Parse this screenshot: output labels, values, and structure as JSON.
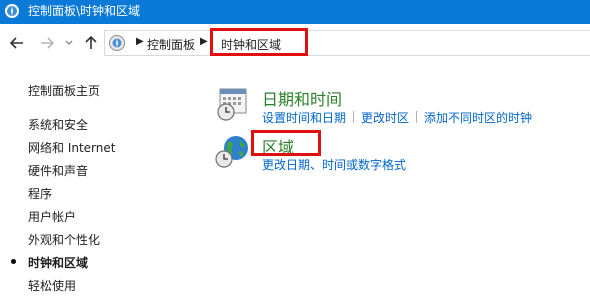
{
  "window": {
    "title": "控制面板\\时钟和区域"
  },
  "address_bar": {
    "icon": "control-panel-icon",
    "breadcrumbs": [
      "控制面板",
      "时钟和区域"
    ]
  },
  "nav": {
    "back_icon": "arrow-left-icon",
    "forward_icon": "arrow-right-icon",
    "recent_icon": "chevron-down-icon",
    "up_icon": "arrow-up-icon"
  },
  "sidebar": {
    "home": "控制面板主页",
    "items": [
      {
        "label": "系统和安全",
        "current": false
      },
      {
        "label": "网络和 Internet",
        "current": false
      },
      {
        "label": "硬件和声音",
        "current": false
      },
      {
        "label": "程序",
        "current": false
      },
      {
        "label": "用户帐户",
        "current": false
      },
      {
        "label": "外观和个性化",
        "current": false
      },
      {
        "label": "时钟和区域",
        "current": true
      },
      {
        "label": "轻松使用",
        "current": false
      }
    ]
  },
  "categories": [
    {
      "title": "日期和时间",
      "icon": "calendar-clock-icon",
      "links": [
        "设置时间和日期",
        "更改时区",
        "添加不同时区的时钟"
      ]
    },
    {
      "title": "区域",
      "icon": "globe-clock-icon",
      "links": [
        "更改日期、时间或数字格式"
      ]
    }
  ],
  "colors": {
    "titlebar": "#0a79d8",
    "category_title": "#2a7f2a",
    "link": "#0066cc",
    "highlight_box": "#e01010"
  }
}
